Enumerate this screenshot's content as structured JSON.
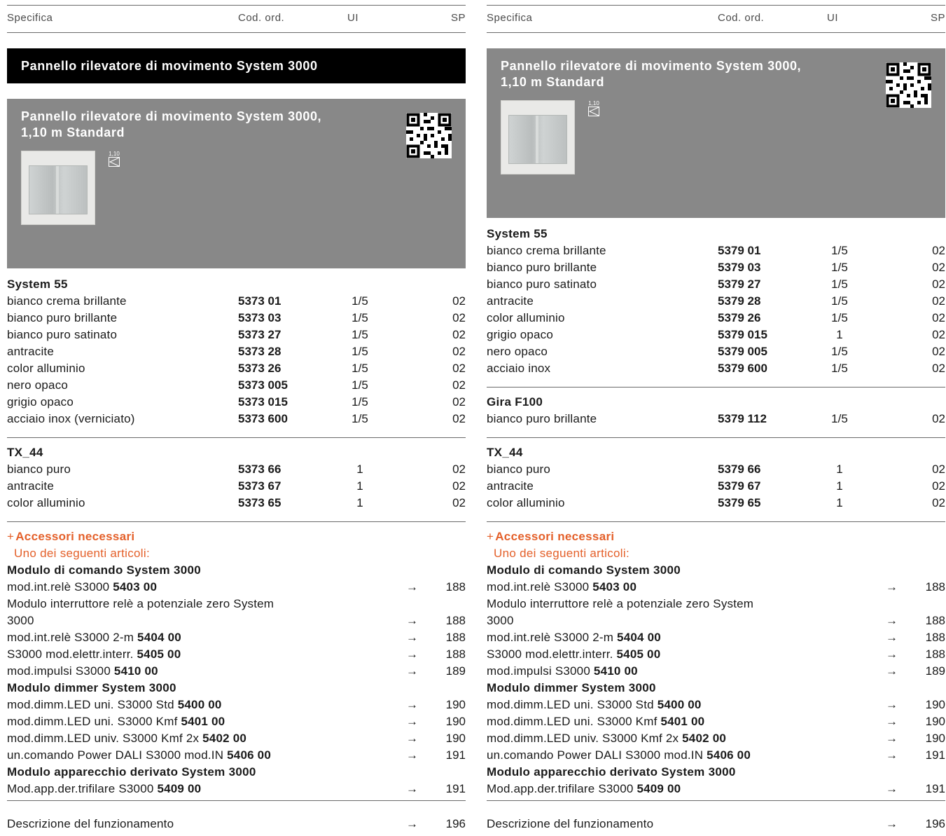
{
  "header": {
    "spec": "Specifica",
    "code": "Cod. ord.",
    "ui": "UI",
    "sp": "SP"
  },
  "left": {
    "section_title": "Pannello rilevatore di movimento System 3000",
    "panel_title_1": "Pannello rilevatore di movimento System 3000,",
    "panel_title_2": "1,10 m Standard",
    "angle_label": "1,10",
    "groups": [
      {
        "title": "System 55",
        "rows": [
          {
            "desc": "bianco crema brillante",
            "code": "5373 01",
            "ui": "1/5",
            "sp": "02"
          },
          {
            "desc": "bianco puro brillante",
            "code": "5373 03",
            "ui": "1/5",
            "sp": "02"
          },
          {
            "desc": "bianco puro satinato",
            "code": "5373 27",
            "ui": "1/5",
            "sp": "02"
          },
          {
            "desc": "antracite",
            "code": "5373 28",
            "ui": "1/5",
            "sp": "02"
          },
          {
            "desc": "color alluminio",
            "code": "5373 26",
            "ui": "1/5",
            "sp": "02"
          },
          {
            "desc": "nero opaco",
            "code": "5373 005",
            "ui": "1/5",
            "sp": "02"
          },
          {
            "desc": "grigio opaco",
            "code": "5373 015",
            "ui": "1/5",
            "sp": "02"
          },
          {
            "desc": "acciaio inox (verniciato)",
            "code": "5373 600",
            "ui": "1/5",
            "sp": "02"
          }
        ]
      },
      {
        "title": "TX_44",
        "rows": [
          {
            "desc": "bianco puro",
            "code": "5373 66",
            "ui": "1",
            "sp": "02"
          },
          {
            "desc": "antracite",
            "code": "5373 67",
            "ui": "1",
            "sp": "02"
          },
          {
            "desc": "color alluminio",
            "code": "5373 65",
            "ui": "1",
            "sp": "02"
          }
        ]
      }
    ]
  },
  "right": {
    "panel_title_1": "Pannello rilevatore di movimento System 3000,",
    "panel_title_2": "1,10 m Standard",
    "angle_label": "1,10",
    "groups": [
      {
        "title": "System 55",
        "rows": [
          {
            "desc": "bianco crema brillante",
            "code": "5379 01",
            "ui": "1/5",
            "sp": "02"
          },
          {
            "desc": "bianco puro brillante",
            "code": "5379 03",
            "ui": "1/5",
            "sp": "02"
          },
          {
            "desc": "bianco puro satinato",
            "code": "5379 27",
            "ui": "1/5",
            "sp": "02"
          },
          {
            "desc": "antracite",
            "code": "5379 28",
            "ui": "1/5",
            "sp": "02"
          },
          {
            "desc": "color alluminio",
            "code": "5379 26",
            "ui": "1/5",
            "sp": "02"
          },
          {
            "desc": "grigio opaco",
            "code": "5379 015",
            "ui": "1",
            "sp": "02"
          },
          {
            "desc": "nero opaco",
            "code": "5379 005",
            "ui": "1/5",
            "sp": "02"
          },
          {
            "desc": "acciaio inox",
            "code": "5379 600",
            "ui": "1/5",
            "sp": "02"
          }
        ]
      },
      {
        "title": "Gira F100",
        "rows": [
          {
            "desc": "bianco puro brillante",
            "code": "5379 112",
            "ui": "1/5",
            "sp": "02"
          }
        ]
      },
      {
        "title": "TX_44",
        "rows": [
          {
            "desc": "bianco puro",
            "code": "5379 66",
            "ui": "1",
            "sp": "02"
          },
          {
            "desc": "antracite",
            "code": "5379 67",
            "ui": "1",
            "sp": "02"
          },
          {
            "desc": "color alluminio",
            "code": "5379 65",
            "ui": "1",
            "sp": "02"
          }
        ]
      }
    ]
  },
  "accessories": {
    "plus": "+",
    "title": "Accessori necessari",
    "subtitle": "Uno dei seguenti articoli:",
    "module_command": "Modulo di comando System 3000",
    "module_dimmer": "Modulo dimmer System 3000",
    "module_derived": "Modulo apparecchio derivato System 3000",
    "arrow": "→",
    "items": [
      {
        "text": "mod.int.relè S3000",
        "code": "5403 00",
        "page": "188"
      },
      {
        "text": "Modulo interruttore relè a potenziale zero System",
        "code": "",
        "page": ""
      },
      {
        "text": "3000",
        "code": "",
        "page": "188"
      },
      {
        "text": "mod.int.relè S3000 2-m",
        "code": "5404 00",
        "page": "188"
      },
      {
        "text": "S3000 mod.elettr.interr.",
        "code": "5405 00",
        "page": "188"
      },
      {
        "text": "mod.impulsi S3000",
        "code": "5410 00",
        "page": "189"
      },
      {
        "text": "mod.dimm.LED uni. S3000 Std",
        "code": "5400 00",
        "page": "190"
      },
      {
        "text": "mod.dimm.LED uni. S3000 Kmf",
        "code": "5401 00",
        "page": "190"
      },
      {
        "text": "mod.dimm.LED univ. S3000 Kmf 2x",
        "code": "5402 00",
        "page": "190"
      },
      {
        "text": "un.comando Power DALI S3000 mod.IN",
        "code": "5406 00",
        "page": "191"
      },
      {
        "text": "Mod.app.der.trifilare S3000",
        "code": "5409 00",
        "page": "191"
      }
    ],
    "description": "Descrizione del funzionamento",
    "description_page": "196"
  },
  "colors": {
    "accent": "#e4602a",
    "panel": "#888888",
    "title_bar": "#000000"
  }
}
